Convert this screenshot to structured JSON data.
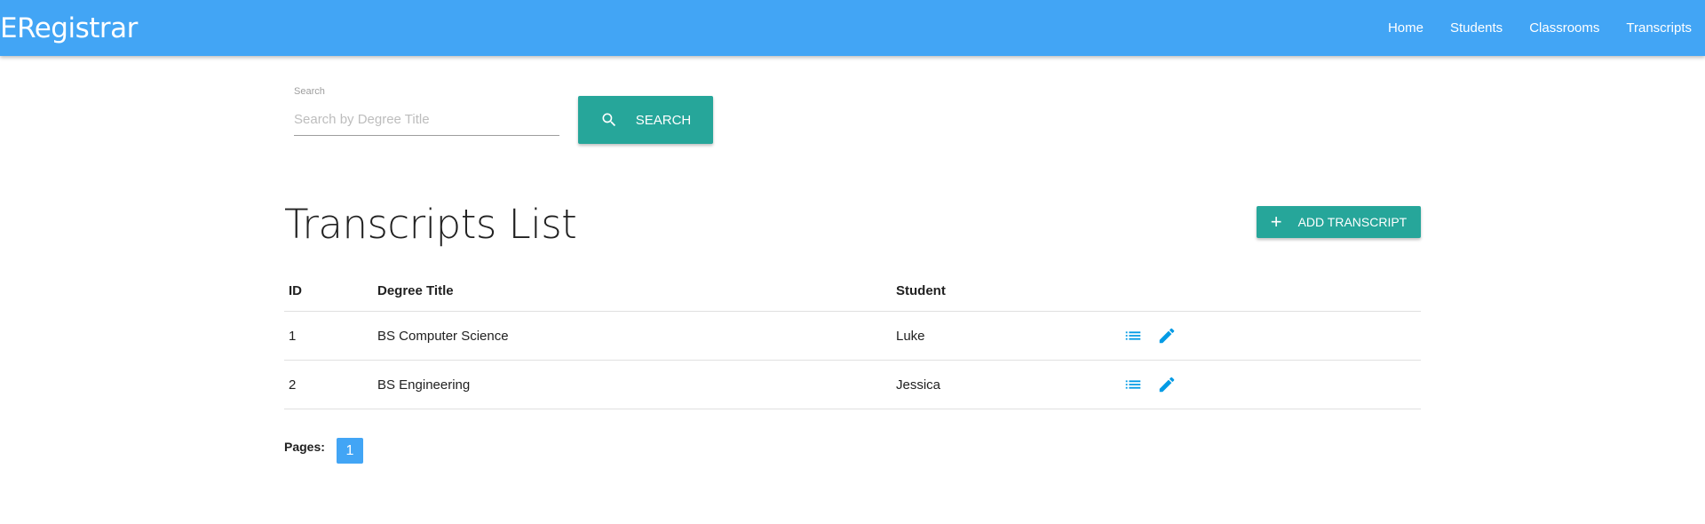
{
  "navbar": {
    "brand": "ERegistrar",
    "links": [
      "Home",
      "Students",
      "Classrooms",
      "Transcripts"
    ]
  },
  "search": {
    "label": "Search",
    "placeholder": "Search by Degree Title",
    "value": "",
    "button_label": "SEARCH",
    "button_icon": "search-icon"
  },
  "page": {
    "title": "Transcripts List",
    "add_button_label": "ADD TRANSCRIPT",
    "add_button_icon": "plus-icon"
  },
  "table": {
    "headers": [
      "ID",
      "Degree Title",
      "Student"
    ],
    "rows": [
      {
        "id": "1",
        "degree_title": "BS Computer Science",
        "student": "Luke"
      },
      {
        "id": "2",
        "degree_title": "BS Engineering",
        "student": "Jessica"
      }
    ],
    "action_icons": [
      "list-icon",
      "edit-pencil-icon"
    ]
  },
  "pagination": {
    "label": "Pages:",
    "pages": [
      "1"
    ],
    "current": "1"
  },
  "colors": {
    "navbar": "#42a5f5",
    "button": "#26a69a",
    "icon": "#039be5"
  }
}
